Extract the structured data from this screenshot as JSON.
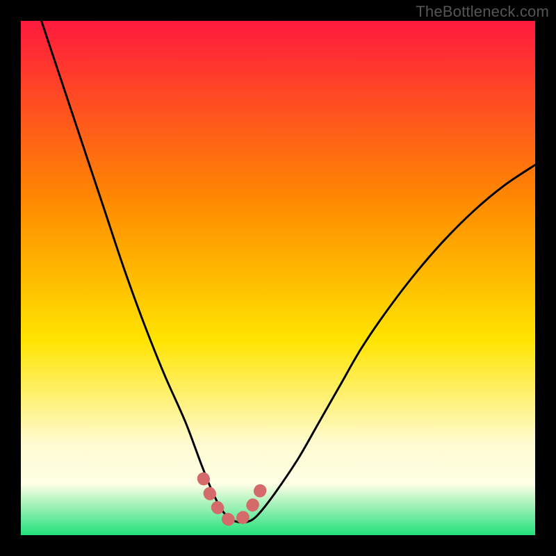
{
  "watermark": "TheBottleneck.com",
  "colors": {
    "frame": "#000000",
    "gradient_top": "#ff1a3d",
    "gradient_mid1": "#ff8a00",
    "gradient_mid2": "#ffe400",
    "gradient_low": "#fffbd0",
    "gradient_band": "#feffe5",
    "gradient_bottom": "#22e07a",
    "curve": "#000000",
    "highlight": "#d46a6a"
  },
  "chart_data": {
    "type": "line",
    "title": "",
    "xlabel": "",
    "ylabel": "",
    "xlim": [
      0,
      100
    ],
    "ylim": [
      0,
      100
    ],
    "grid": false,
    "series": [
      {
        "name": "bottleneck-curve",
        "x": [
          4,
          8,
          12,
          16,
          20,
          24,
          28,
          32,
          35,
          37,
          39,
          41,
          43,
          45,
          47,
          50,
          54,
          58,
          62,
          66,
          70,
          76,
          82,
          88,
          94,
          100
        ],
        "y": [
          100,
          88,
          76,
          64,
          52,
          41,
          31,
          22,
          14,
          9,
          5,
          3,
          2.5,
          3,
          5,
          9,
          15,
          22,
          29,
          36,
          42,
          50,
          57,
          63,
          68,
          72
        ]
      },
      {
        "name": "highlight-trough",
        "x": [
          35.5,
          37,
          38.5,
          40,
          41.5,
          43,
          44.5,
          46,
          47.5
        ],
        "y": [
          11,
          7.5,
          5,
          3.3,
          2.7,
          3.3,
          5,
          7.5,
          11
        ]
      }
    ],
    "annotations": []
  }
}
